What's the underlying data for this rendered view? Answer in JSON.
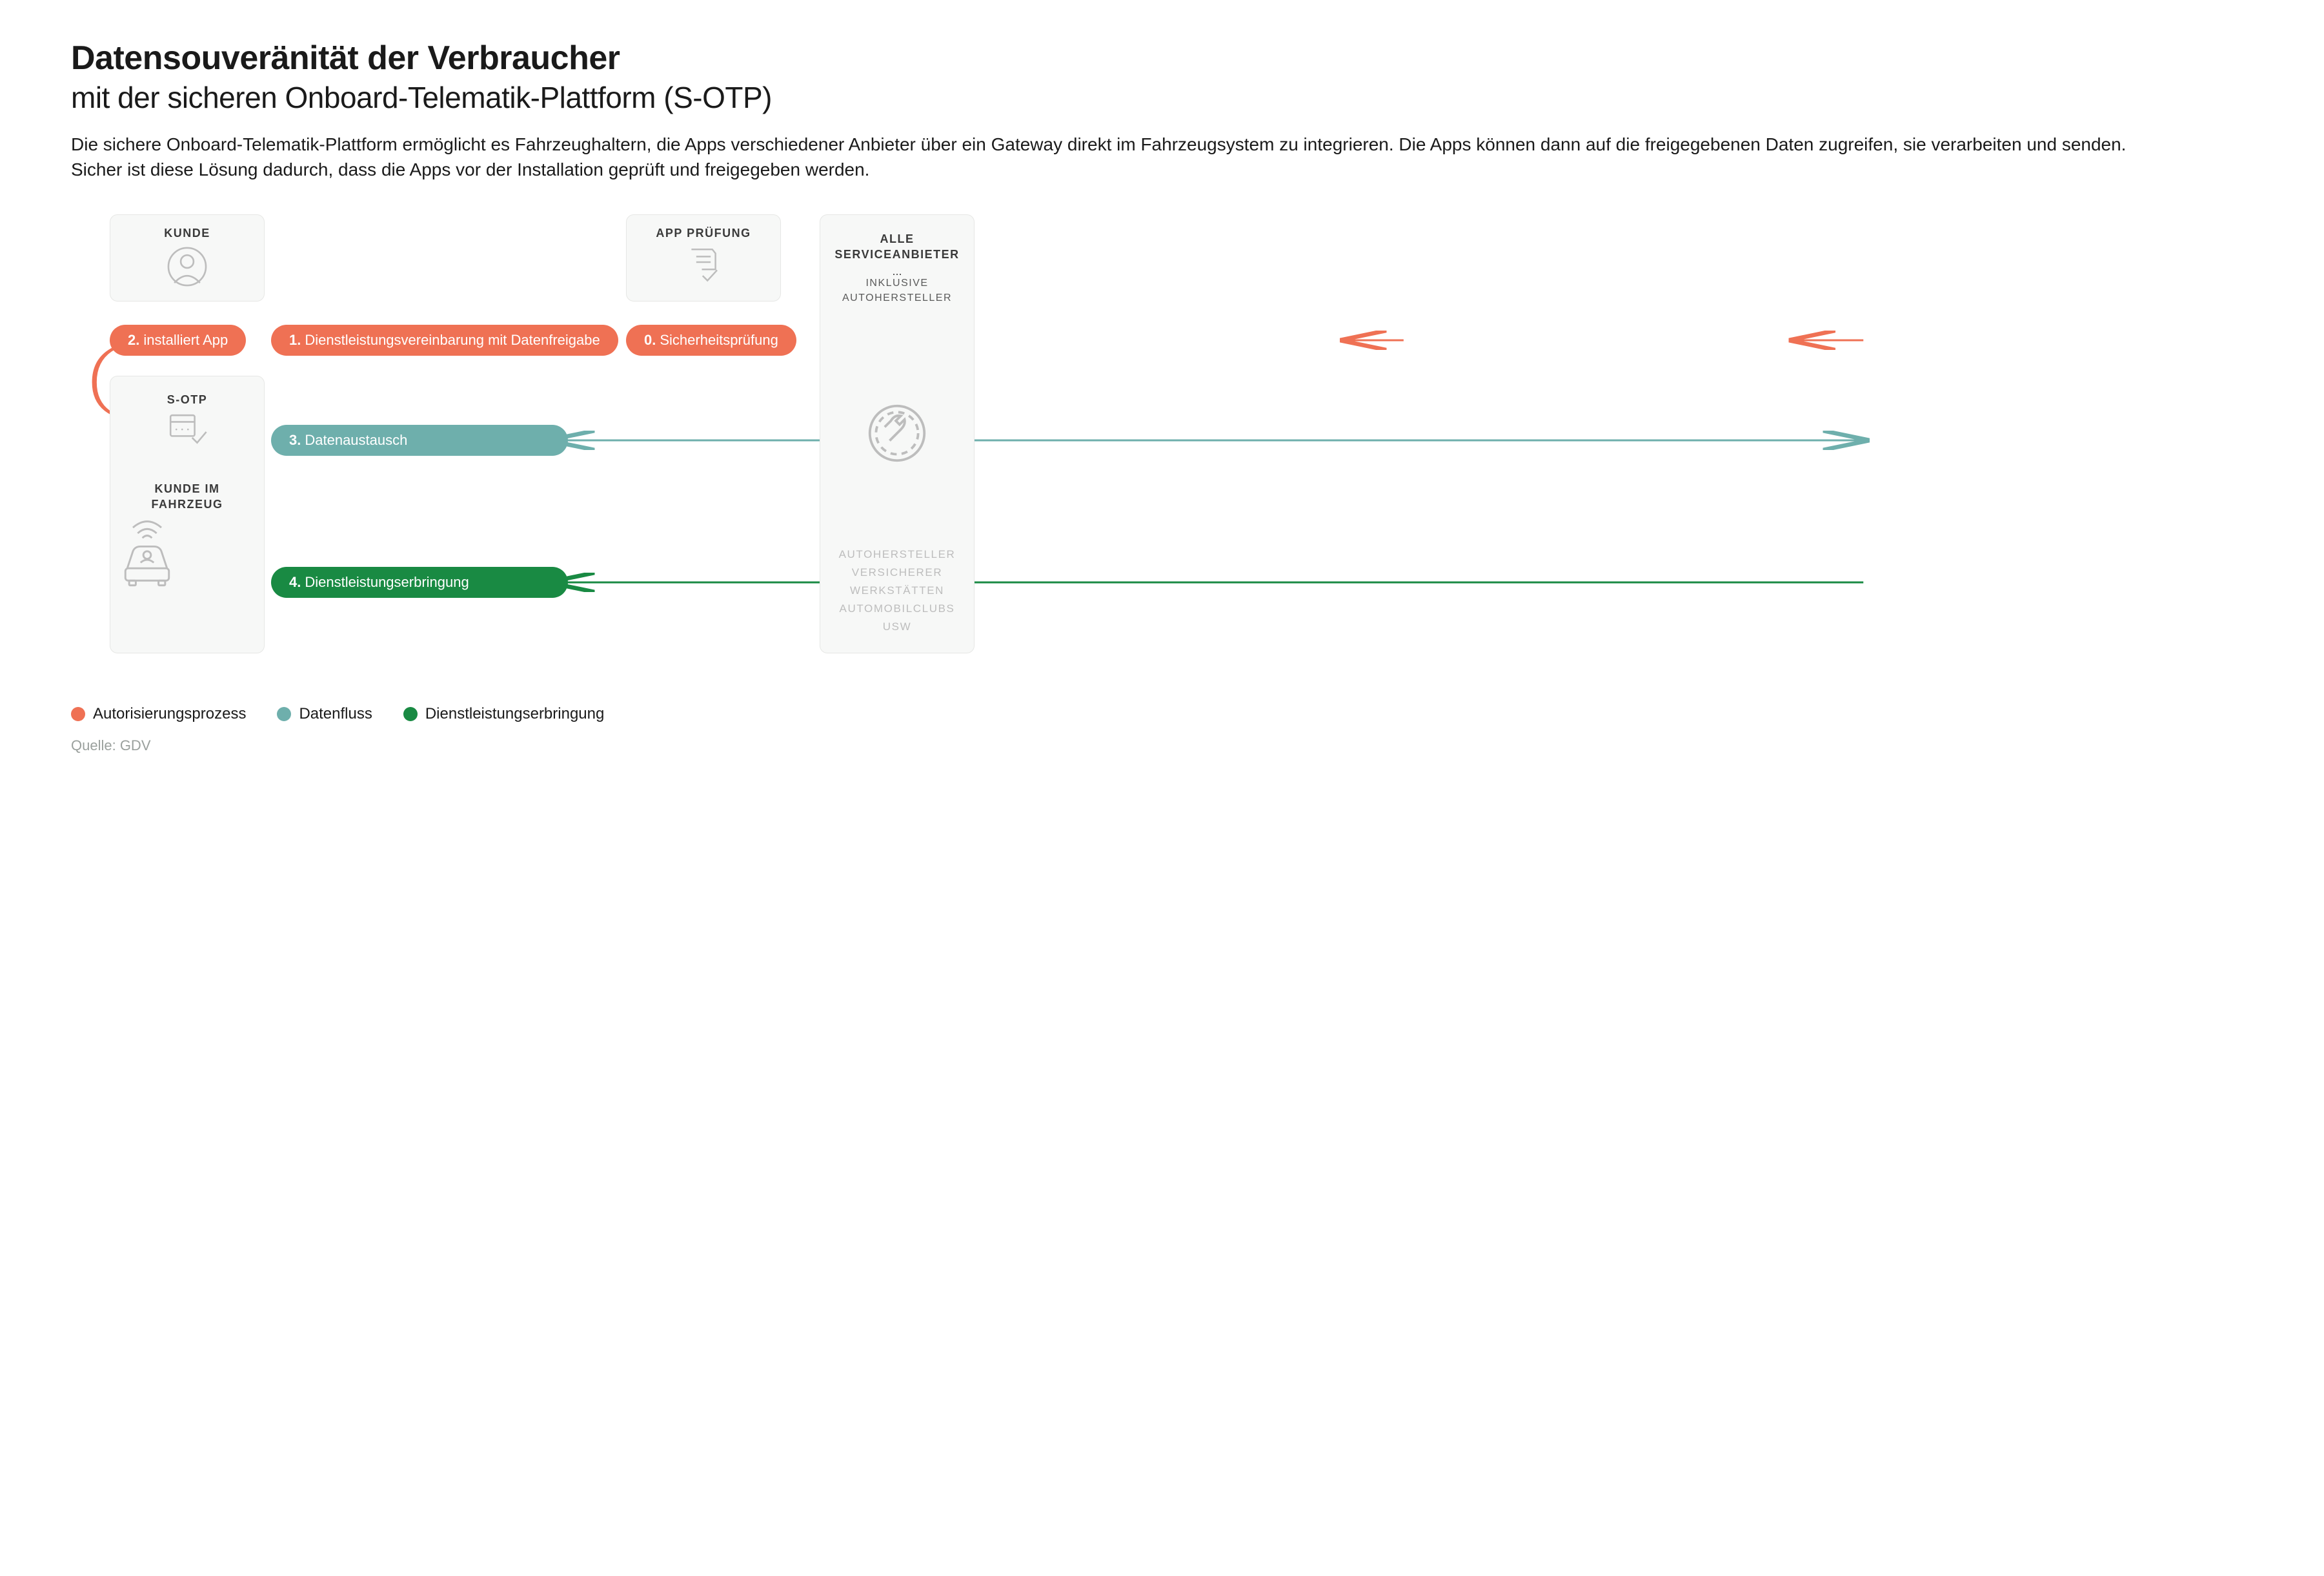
{
  "title": "Datensouveränität der Verbraucher",
  "subtitle": "mit der sicheren Onboard-Telematik-Plattform (S-OTP)",
  "lead": "Die sichere Onboard-Telematik-Plattform ermöglicht es Fahrzeughaltern, die Apps verschiedener Anbieter über ein Gateway direkt im Fahrzeugsystem zu integrieren. Die Apps können dann auf die freigegebenen Daten zugreifen, sie verarbeiten und senden. Sicher ist diese Lösung dadurch, dass die Apps vor der Installation geprüft und freigegeben werden.",
  "cards": {
    "kunde": "KUNDE",
    "app_pruefung": "APP PRÜFUNG",
    "sotp": "S-OTP",
    "kunde_im_fahrzeug": "KUNDE IM FAHRZEUG",
    "serviceanbieter_title": "ALLE SERVICEANBIETER",
    "serviceanbieter_sub": "INKLUSIVE AUTOHERSTELLER",
    "service_list": [
      "AUTOHERSTELLER",
      "VERSICHERER",
      "WERKSTÄTTEN",
      "AUTOMOBILCLUBS",
      "USW"
    ]
  },
  "steps": {
    "s0": {
      "num": "0.",
      "text": "Sicherheitsprüfung"
    },
    "s1": {
      "num": "1.",
      "text": "Dienstleistungsvereinbarung mit Datenfreigabe"
    },
    "s2": {
      "num": "2.",
      "text": "installiert App"
    },
    "s3": {
      "num": "3.",
      "text": "Datenaustausch"
    },
    "s4": {
      "num": "4.",
      "text": "Dienstleistungserbringung"
    }
  },
  "legend": {
    "auth": "Autorisierungsprozess",
    "data": "Datenfluss",
    "service": "Dienstleistungserbringung"
  },
  "source_label": "Quelle: GDV",
  "colors": {
    "orange": "#ef7154",
    "teal": "#6eafac",
    "green": "#198a43"
  }
}
